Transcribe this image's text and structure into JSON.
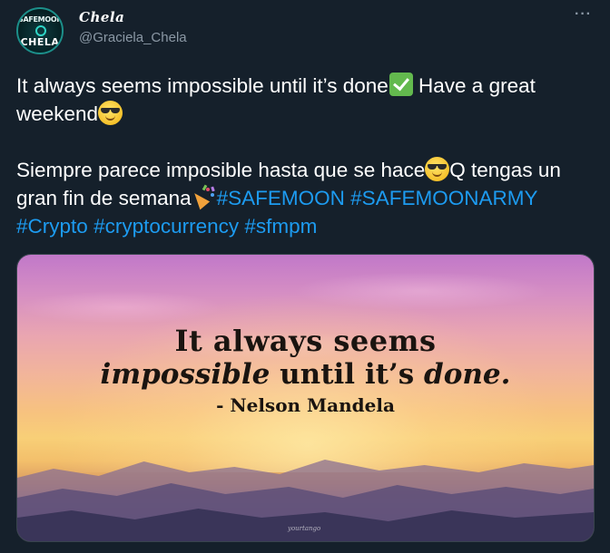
{
  "author": {
    "name": "Chela",
    "handle": "@Graciela_Chela",
    "avatar_text_top": "SAFEMOON",
    "avatar_text_bottom": "CHELA"
  },
  "menu": {
    "more_icon": "more-horizontal-icon"
  },
  "tweet": {
    "line1_part1": "It always seems impossible until it’s done",
    "line1_part2": " Have a great weekend",
    "line2_part1": "Siempre parece imposible hasta que se hace",
    "line2_part2": "Q tengas un gran fin de semana",
    "hashtags": [
      "#SAFEMOON",
      "#SAFEMOONARMY",
      "#Crypto",
      "#cryptocurrency",
      "#sfmpm"
    ]
  },
  "media": {
    "quote_line1": "It always seems",
    "quote_line2_em": "impossible",
    "quote_line2_rest": " until it’s ",
    "quote_line2_em2": "done.",
    "quote_attribution": "- Nelson Mandela",
    "watermark": "yourtango"
  },
  "colors": {
    "background": "#15202b",
    "text": "#ffffff",
    "secondary": "#8b98a5",
    "link": "#1d9bf0",
    "border": "#38444d"
  }
}
